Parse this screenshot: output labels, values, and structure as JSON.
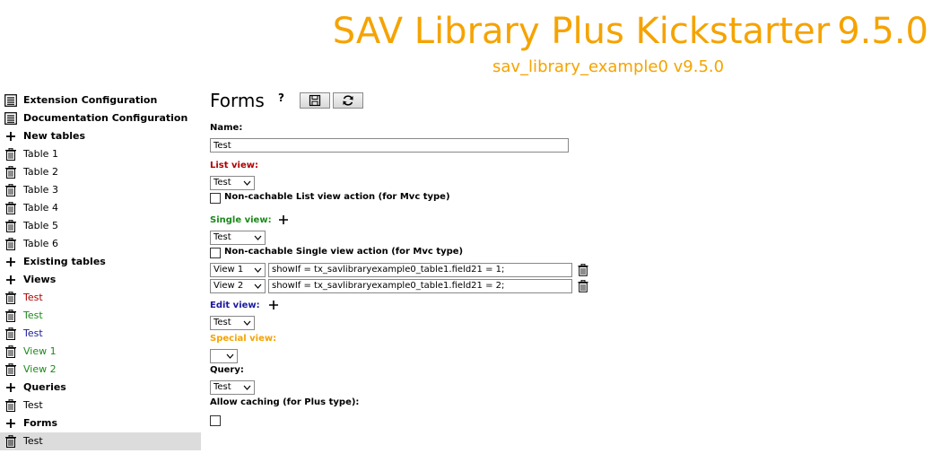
{
  "header": {
    "title": "SAV Library Plus Kickstarter",
    "version": "9.5.0",
    "subtitle": "sav_library_example0 v9.5.0"
  },
  "sidebar": {
    "items": [
      {
        "label": "Extension Configuration",
        "icon": "document-list-icon",
        "style": "bold"
      },
      {
        "label": "Documentation Configuration",
        "icon": "document-list-icon",
        "style": "bold"
      },
      {
        "label": "New tables",
        "icon": "plus-icon",
        "style": "bold"
      },
      {
        "label": "Table 1",
        "icon": "trash-icon",
        "style": "normal"
      },
      {
        "label": "Table 2",
        "icon": "trash-icon",
        "style": "normal"
      },
      {
        "label": "Table 3",
        "icon": "trash-icon",
        "style": "normal"
      },
      {
        "label": "Table 4",
        "icon": "trash-icon",
        "style": "normal"
      },
      {
        "label": "Table 5",
        "icon": "trash-icon",
        "style": "normal"
      },
      {
        "label": "Table 6",
        "icon": "trash-icon",
        "style": "normal"
      },
      {
        "label": "Existing tables",
        "icon": "plus-icon",
        "style": "bold"
      },
      {
        "label": "Views",
        "icon": "plus-icon",
        "style": "bold"
      },
      {
        "label": "Test",
        "icon": "trash-icon",
        "style": "red"
      },
      {
        "label": "Test",
        "icon": "trash-icon",
        "style": "green"
      },
      {
        "label": "Test",
        "icon": "trash-icon",
        "style": "blue"
      },
      {
        "label": "View 1",
        "icon": "trash-icon",
        "style": "green"
      },
      {
        "label": "View 2",
        "icon": "trash-icon",
        "style": "green"
      },
      {
        "label": "Queries",
        "icon": "plus-icon",
        "style": "bold"
      },
      {
        "label": "Test",
        "icon": "trash-icon",
        "style": "normal"
      },
      {
        "label": "Forms",
        "icon": "plus-icon",
        "style": "bold"
      },
      {
        "label": "Test",
        "icon": "trash-icon",
        "style": "active"
      }
    ]
  },
  "main": {
    "title": "Forms",
    "help": "?",
    "name_label": "Name:",
    "name_value": "Test",
    "list_view_label": "List view:",
    "list_view_value": "Test",
    "list_noncache_label": "Non-cachable List view action (for Mvc type)",
    "single_view_label": "Single view:",
    "single_view_value": "Test",
    "single_noncache_label": "Non-cachable Single view action (for Mvc type)",
    "single_views": [
      {
        "view": "View 1",
        "condition": "showIf = tx_savlibraryexample0_table1.field21 = 1;"
      },
      {
        "view": "View 2",
        "condition": "showIf = tx_savlibraryexample0_table1.field21 = 2;"
      }
    ],
    "edit_view_label": "Edit view:",
    "edit_view_value": "Test",
    "special_view_label": "Special view:",
    "special_view_value": "",
    "query_label": "Query:",
    "query_value": "Test",
    "caching_label": "Allow caching (for Plus type):"
  },
  "colors": {
    "title": "#f5a300",
    "list_view": "#b00000",
    "single_view": "#1a8a1a",
    "edit_view": "#1a1aa0",
    "special_view": "#f5a300",
    "active_row": "#dcdcdc"
  }
}
